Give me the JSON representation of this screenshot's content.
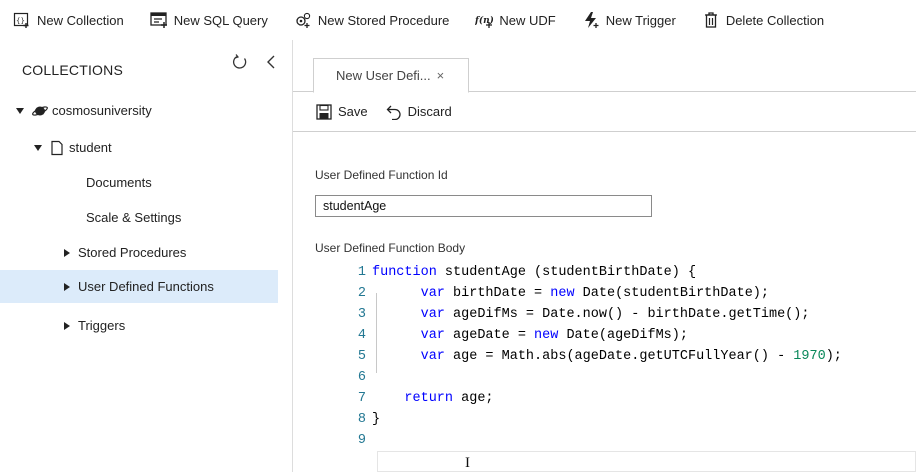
{
  "toolbar": {
    "new_collection": "New Collection",
    "new_sql_query": "New SQL Query",
    "new_stored_procedure": "New Stored Procedure",
    "new_udf": "New UDF",
    "new_trigger": "New Trigger",
    "delete_collection": "Delete Collection"
  },
  "sidebar": {
    "header": "COLLECTIONS",
    "database": "cosmosuniversity",
    "collection": "student",
    "items": [
      {
        "label": "Documents"
      },
      {
        "label": "Scale & Settings"
      },
      {
        "label": "Stored Procedures"
      },
      {
        "label": "User Defined Functions"
      },
      {
        "label": "Triggers"
      }
    ]
  },
  "tab": {
    "label": "New User Defi...",
    "close": "×"
  },
  "commands": {
    "save": "Save",
    "discard": "Discard"
  },
  "form": {
    "id_label": "User Defined Function Id",
    "id_value": "studentAge",
    "body_label": "User Defined Function Body"
  },
  "code": {
    "line_numbers": [
      "1",
      "2",
      "3",
      "4",
      "5",
      "6",
      "7",
      "8",
      "9"
    ],
    "line1_kw": "function",
    "line1_rest": " studentAge (studentBirthDate) {",
    "line2_kw1": "var",
    "line2_mid": " birthDate = ",
    "line2_kw2": "new",
    "line2_rest": " Date(studentBirthDate);",
    "line3_kw": "var",
    "line3_rest": " ageDifMs = Date.now() - birthDate.getTime();",
    "line4_kw1": "var",
    "line4_mid": " ageDate = ",
    "line4_kw2": "new",
    "line4_rest": " Date(ageDifMs);",
    "line5_kw": "var",
    "line5_mid": " age = Math.abs(ageDate.getUTCFullYear() - ",
    "line5_num": "1970",
    "line5_rest": ");",
    "line7_kw": "return",
    "line7_rest": " age;",
    "line8_text": "}",
    "cursor_glyph": "I"
  },
  "colors": {
    "selected_bg": "#dcebfa",
    "keyword": "#0000ff",
    "line_number": "#237893",
    "number": "#09885a"
  }
}
